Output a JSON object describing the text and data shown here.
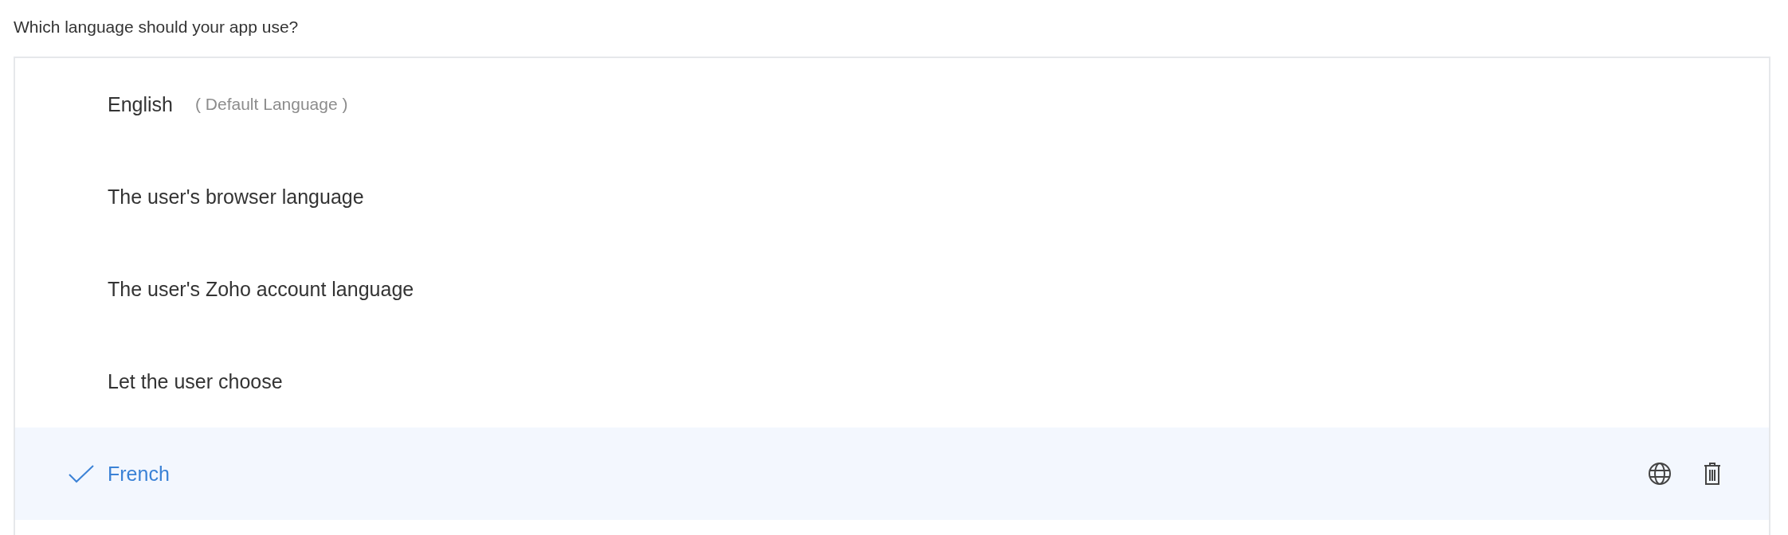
{
  "question": "Which language should your app use?",
  "options": [
    {
      "label": "English",
      "note": "( Default Language )",
      "selected": false
    },
    {
      "label": "The user's browser language",
      "selected": false
    },
    {
      "label": "The user's Zoho account language",
      "selected": false
    },
    {
      "label": "Let the user choose",
      "selected": false
    },
    {
      "label": "French",
      "selected": true
    }
  ]
}
